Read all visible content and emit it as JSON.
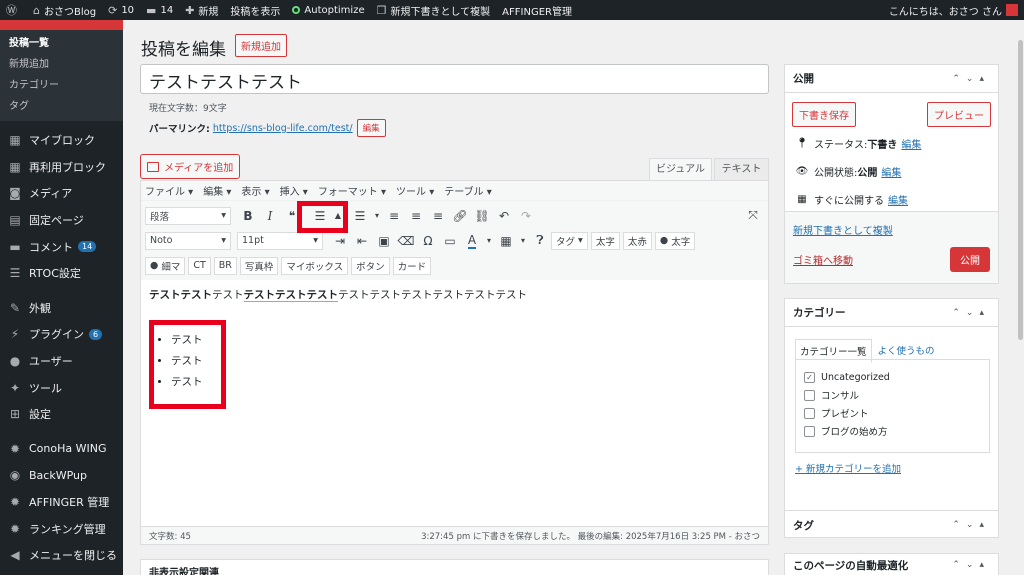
{
  "adminbar": {
    "site_name": "おさつBlog",
    "updates": "10",
    "comments": "14",
    "new": "新規",
    "view_post": "投稿を表示",
    "autoptimize": "Autoptimize",
    "duplicate": "新規下書きとして複製",
    "affinger": "AFFINGER管理",
    "greeting": "こんにちは、おさつ さん"
  },
  "sidebar": {
    "current": "投稿",
    "submenu": [
      "投稿一覧",
      "新規追加",
      "カテゴリー",
      "タグ"
    ],
    "items": [
      {
        "icon": "blocks-icon",
        "glyph": "▦",
        "label": "マイブロック"
      },
      {
        "icon": "blocks-icon",
        "glyph": "▦",
        "label": "再利用ブロック"
      },
      {
        "icon": "media-icon",
        "glyph": "◙",
        "label": "メディア"
      },
      {
        "icon": "page-icon",
        "glyph": "▤",
        "label": "固定ページ"
      },
      {
        "icon": "comment-icon",
        "glyph": "▬",
        "label": "コメント",
        "badge": "14"
      },
      {
        "icon": "list-icon",
        "glyph": "☰",
        "label": "RTOC設定"
      },
      {
        "icon": "brush-icon",
        "glyph": "✎",
        "label": "外観"
      },
      {
        "icon": "plugin-icon",
        "glyph": "⚡",
        "label": "プラグイン",
        "badge": "6"
      },
      {
        "icon": "user-icon",
        "glyph": "●",
        "label": "ユーザー"
      },
      {
        "icon": "wrench-icon",
        "glyph": "✦",
        "label": "ツール"
      },
      {
        "icon": "settings-icon",
        "glyph": "⊞",
        "label": "設定"
      },
      {
        "icon": "gear-icon",
        "glyph": "✹",
        "label": "ConoHa WING"
      },
      {
        "icon": "backup-icon",
        "glyph": "◉",
        "label": "BackWPup"
      },
      {
        "icon": "gear-icon",
        "glyph": "✹",
        "label": "AFFINGER 管理"
      },
      {
        "icon": "gear-icon",
        "glyph": "✹",
        "label": "ランキング管理"
      },
      {
        "icon": "collapse-icon",
        "glyph": "◀",
        "label": "メニューを閉じる"
      }
    ]
  },
  "main": {
    "page_title": "投稿を編集",
    "add_new": "新規追加",
    "post_title": "テストテストテスト",
    "char_count": "現在文字数：9文字",
    "permalink_label": "パーマリンク:",
    "permalink_url": "https://sns-blog-life.com/test/",
    "permalink_edit": "編集",
    "add_media": "メディアを追加",
    "tab_visual": "ビジュアル",
    "tab_text": "テキスト",
    "menubar": [
      "ファイル ▾",
      "編集 ▾",
      "表示 ▾",
      "挿入 ▾",
      "フォーマット ▾",
      "ツール ▾",
      "テーブル ▾"
    ],
    "format_select": "段落",
    "font_select": "Noto",
    "size_select": "11pt",
    "tag_select": "タグ",
    "row2_buttons_a": [
      "太字",
      "太赤"
    ],
    "row2_button_bold_person": "太字",
    "row3_buttons": [
      "細マ",
      "CT",
      "BR",
      "写真枠",
      "マイボックス",
      "ボタン",
      "カード"
    ],
    "content": {
      "p_bold1": "テストテスト",
      "p_normal1": "テスト",
      "p_bold2": "テストテストテスト",
      "p_normal2": "テストテストテストテストテストテスト",
      "list": [
        "テスト",
        "テスト",
        "テスト"
      ]
    },
    "status_count": "文字数: 45",
    "status_saved": "3:27:45 pm に下書きを保存しました。 最後の編集: 2025年7月16日 3:25 PM - おさつ",
    "bottom_box": "非表示設定関連"
  },
  "publish": {
    "title": "公開",
    "save_draft": "下書き保存",
    "preview": "プレビュー",
    "status_label": "ステータス:",
    "status_value": "下書き",
    "visibility_label": "公開状態:",
    "visibility_value": "公開",
    "schedule_label": "すぐに公開する",
    "edit": "編集",
    "duplicate": "新規下書きとして複製",
    "trash": "ゴミ箱へ移動",
    "publish": "公開"
  },
  "category": {
    "title": "カテゴリー",
    "tab_all": "カテゴリー一覧",
    "tab_popular": "よく使うもの",
    "items": [
      {
        "label": "Uncategorized",
        "checked": true
      },
      {
        "label": "コンサル",
        "checked": false
      },
      {
        "label": "プレゼント",
        "checked": false
      },
      {
        "label": "ブログの始め方",
        "checked": false
      }
    ],
    "add_new": "+ 新規カテゴリーを追加"
  },
  "tags_box": {
    "title": "タグ"
  },
  "auto_box": {
    "title": "このページの自動最適化"
  },
  "colors": {
    "accent": "#d63638",
    "link": "#2271b1",
    "highlight": "#e8001c"
  }
}
